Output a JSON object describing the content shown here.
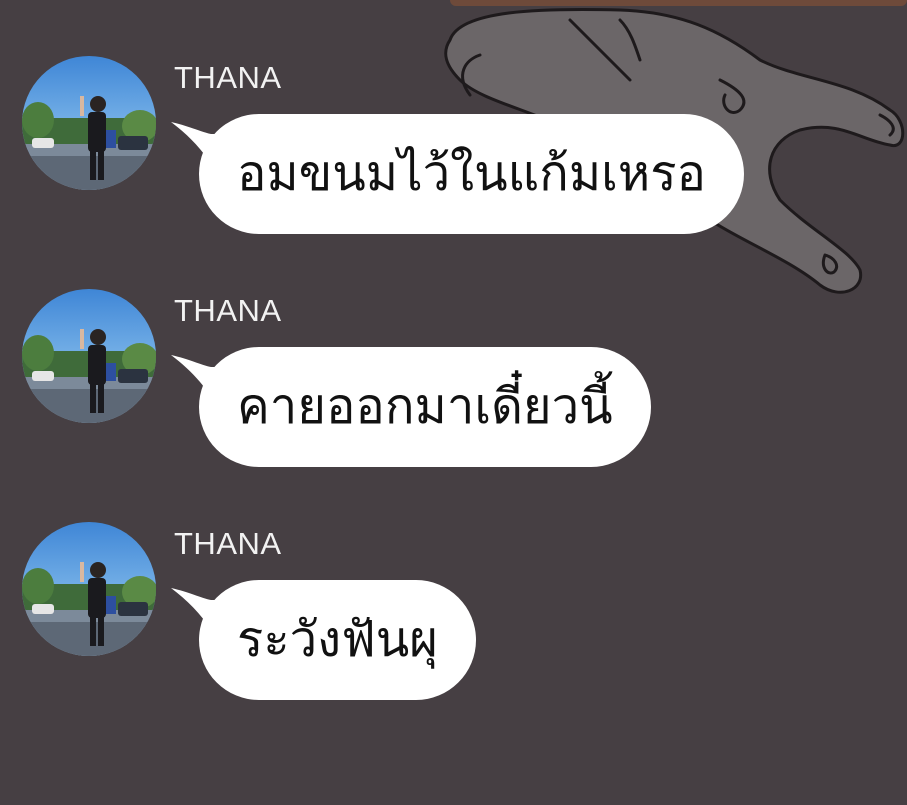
{
  "theme": {
    "background": "#463f43",
    "bubble_color": "#ffffff",
    "sender_color": "#f2f2f2",
    "text_color": "#111111"
  },
  "messages": [
    {
      "sender": "THANA",
      "text": "อมขนมไว้ในแก้มเหรอ",
      "avatar_icon": "user-photo-avatar"
    },
    {
      "sender": "THANA",
      "text": "คายออกมาเดี๋ยวนี้",
      "avatar_icon": "user-photo-avatar"
    },
    {
      "sender": "THANA",
      "text": "ระวังฟันผุ",
      "avatar_icon": "user-photo-avatar"
    }
  ]
}
